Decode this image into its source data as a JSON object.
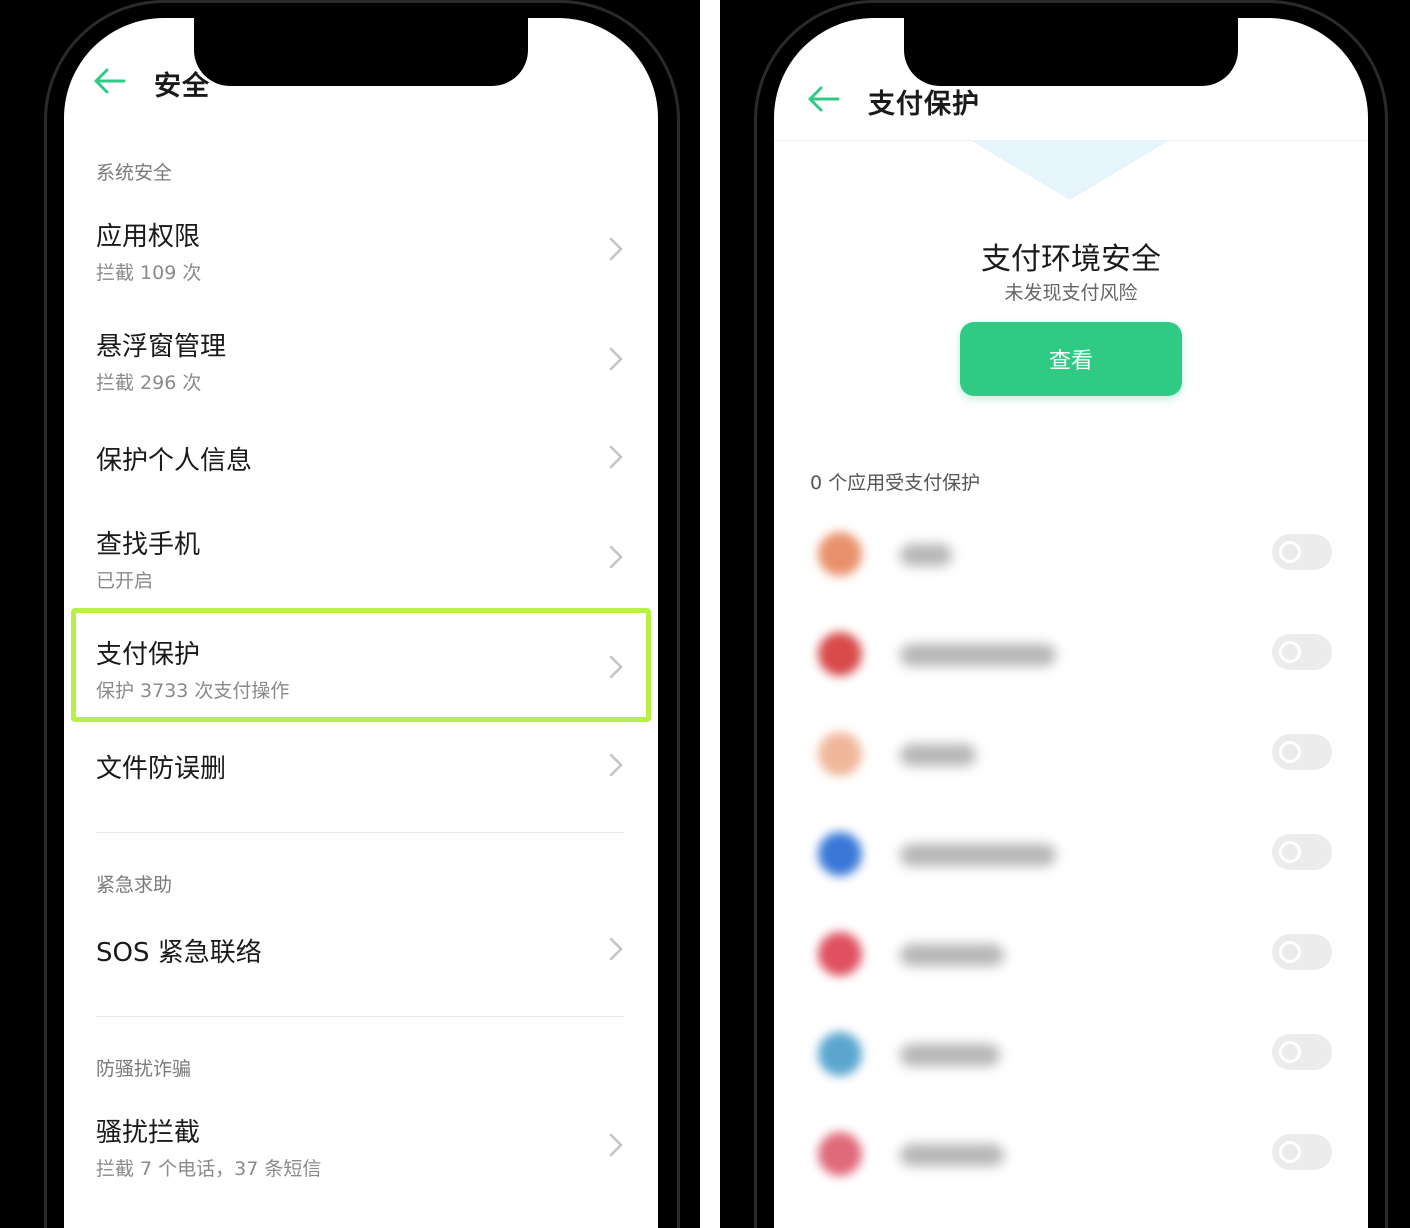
{
  "left_screen": {
    "header": {
      "title": "安全"
    },
    "sections": [
      {
        "label": "系统安全",
        "items": [
          {
            "title": "应用权限",
            "subtitle": "拦截 109 次"
          },
          {
            "title": "悬浮窗管理",
            "subtitle": "拦截 296 次"
          },
          {
            "title": "保护个人信息",
            "subtitle": ""
          },
          {
            "title": "查找手机",
            "subtitle": "已开启"
          },
          {
            "title": "支付保护",
            "subtitle": "保护 3733 次支付操作"
          },
          {
            "title": "文件防误删",
            "subtitle": ""
          }
        ]
      },
      {
        "label": "紧急求助",
        "items": [
          {
            "title": "SOS 紧急联络",
            "subtitle": ""
          }
        ]
      },
      {
        "label": "防骚扰诈骗",
        "items": [
          {
            "title": "骚扰拦截",
            "subtitle": "拦截 7 个电话，37 条短信"
          }
        ]
      }
    ]
  },
  "right_screen": {
    "header": {
      "title": "支付保护"
    },
    "status": {
      "title": "支付环境安全",
      "subtitle": "未发现支付风险",
      "button": "查看"
    },
    "apps_label": "0 个应用受支付保护",
    "apps": [
      {
        "icon_color": "#e8916b",
        "toggle_on": false
      },
      {
        "icon_color": "#d84a4a",
        "toggle_on": false
      },
      {
        "icon_color": "#f0b79a",
        "toggle_on": false
      },
      {
        "icon_color": "#3a78d8",
        "toggle_on": false
      },
      {
        "icon_color": "#e05060",
        "toggle_on": false
      },
      {
        "icon_color": "#5aa6d0",
        "toggle_on": false
      },
      {
        "icon_color": "#e06a7a",
        "toggle_on": false
      }
    ]
  },
  "colors": {
    "accent_green": "#2fcb85",
    "highlight": "#b9f046"
  }
}
